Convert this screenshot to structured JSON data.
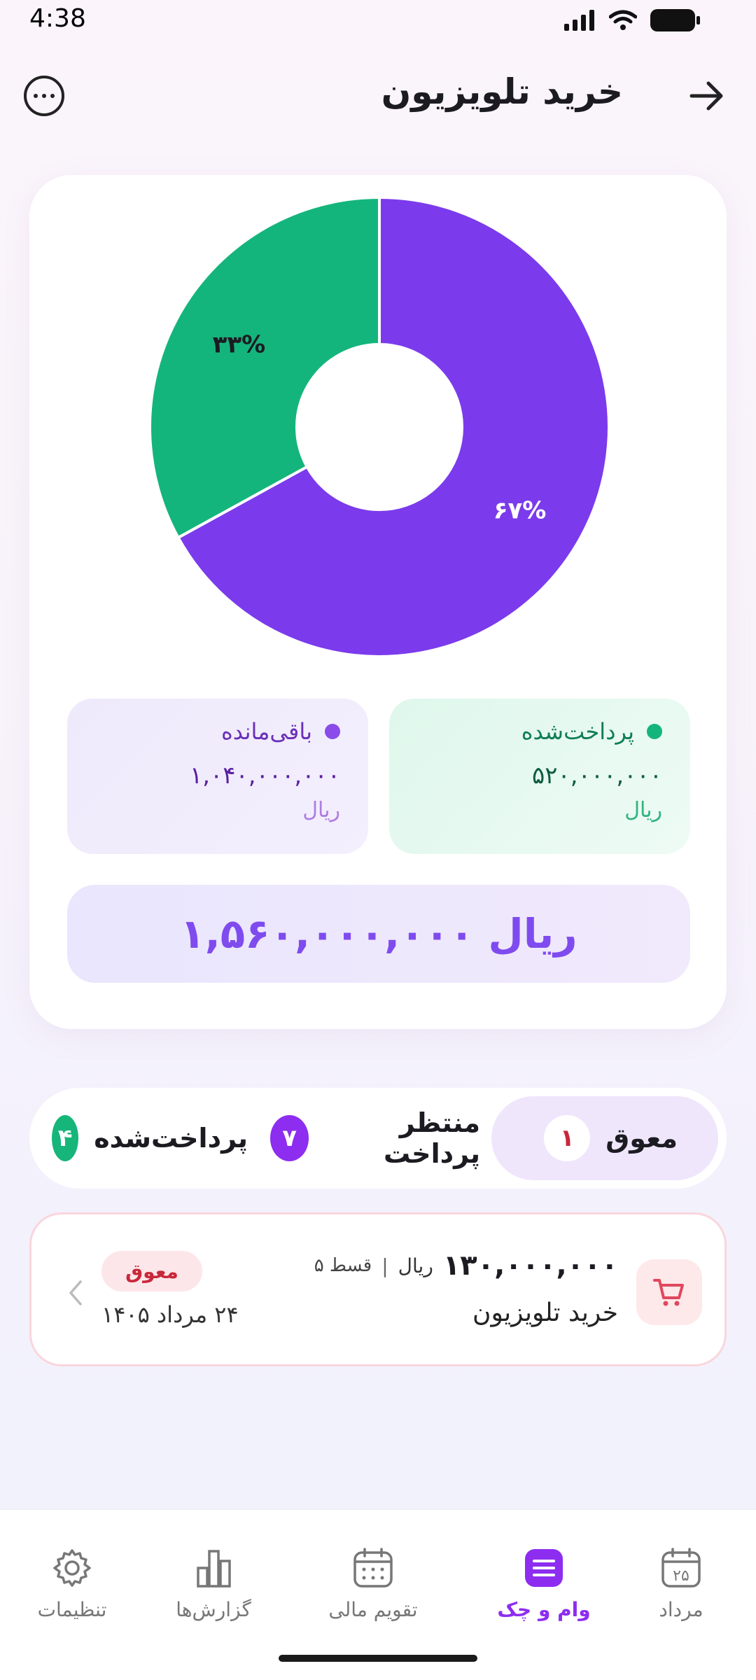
{
  "status_bar": {
    "time": "4:38"
  },
  "header": {
    "title": "خرید تلویزیون"
  },
  "chart_data": {
    "type": "pie",
    "categories": [
      "باقی‌مانده",
      "پرداخت‌شده"
    ],
    "values": [
      67,
      33
    ],
    "labels": [
      "۶۷%",
      "۳۳%"
    ],
    "colors": [
      "#7b3bec",
      "#14b57c"
    ],
    "donut": true
  },
  "legend": {
    "paid": {
      "label": "پرداخت‌شده",
      "value": "۵۲۰,۰۰۰,۰۰۰",
      "unit": "ریال",
      "color": "#14b57c"
    },
    "remaining": {
      "label": "باقی‌مانده",
      "value": "۱,۰۴۰,۰۰۰,۰۰۰",
      "unit": "ریال",
      "color": "#8a4bea"
    }
  },
  "total": {
    "amount": "۱,۵۶۰,۰۰۰,۰۰۰",
    "unit": "ریال"
  },
  "tabs": [
    {
      "label": "معوق",
      "count": "۱",
      "selected": true
    },
    {
      "label": "منتظر پرداخت",
      "count": "۷"
    },
    {
      "label": "پرداخت‌شده",
      "count": "۴"
    }
  ],
  "loan_item": {
    "amount": "۱۳۰,۰۰۰,۰۰۰",
    "unit": "ریال",
    "separator": "|",
    "installment": "قسط ۵",
    "name": "خرید تلویزیون",
    "status": "معوق",
    "due_date": "۲۴ مرداد ۱۴۰۵",
    "icon": "cart-icon"
  },
  "bottom_nav": {
    "items": [
      {
        "label": "مرداد",
        "icon": "calendar-25-icon",
        "date_number": "۲۵"
      },
      {
        "label": "وام و چک",
        "icon": "list-icon",
        "active": true
      },
      {
        "label": "تقویم مالی",
        "icon": "calendar-icon"
      },
      {
        "label": "گزارش‌ها",
        "icon": "bar-chart-icon"
      },
      {
        "label": "تنظیمات",
        "icon": "gear-icon"
      }
    ]
  },
  "colors": {
    "accent": "#8d2df0",
    "paid": "#14b57c",
    "remaining": "#7b3bec",
    "overdue": "#c8283a"
  }
}
